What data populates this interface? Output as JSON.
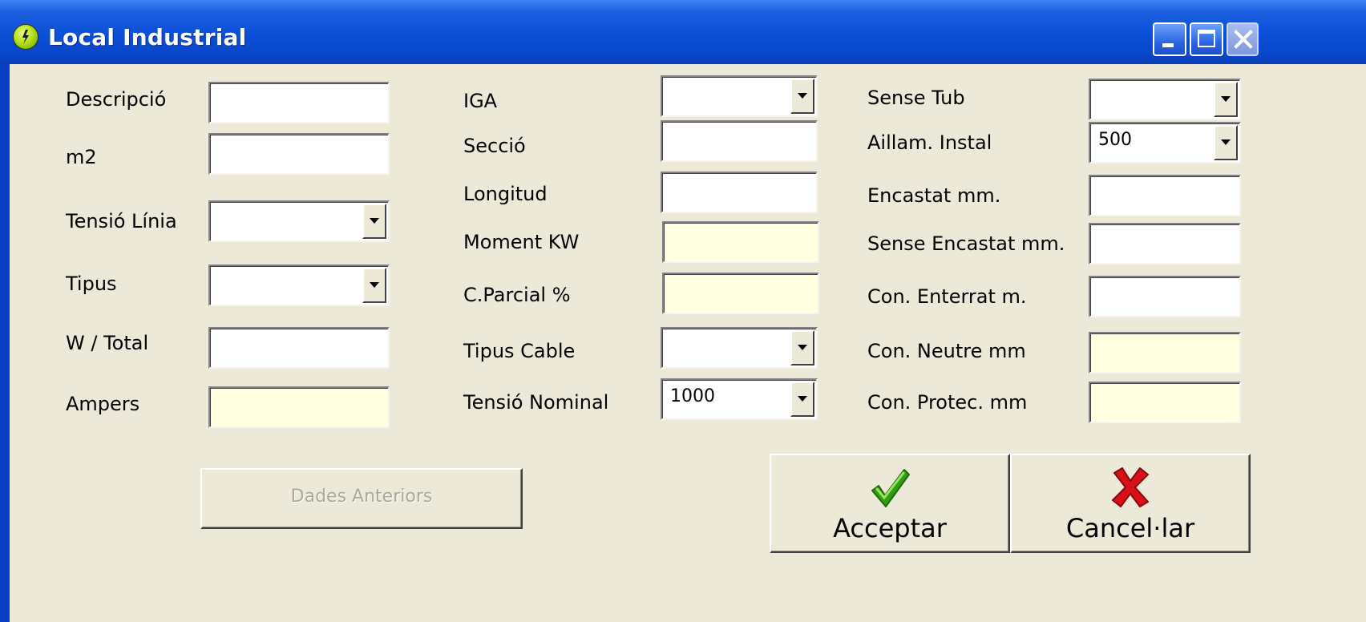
{
  "window": {
    "title": "Local Industrial",
    "icon": "app-logo-icon",
    "controls": [
      "minimize-icon",
      "maximize-icon",
      "close-icon"
    ],
    "colors": {
      "titlebar": "#0a4fd8",
      "client": "#ece9d8",
      "readonly_field": "#ffffe0"
    }
  },
  "col1": {
    "descripcio": {
      "label": "Descripció",
      "value": ""
    },
    "m2": {
      "label": "m2",
      "value": ""
    },
    "tensio_linia": {
      "label": "Tensió Línia",
      "value": ""
    },
    "tipus": {
      "label": "Tipus",
      "value": ""
    },
    "w_total": {
      "label": "W / Total",
      "value": ""
    },
    "ampers": {
      "label": "Ampers",
      "value": ""
    }
  },
  "col2": {
    "iga": {
      "label": "IGA",
      "value": ""
    },
    "seccio": {
      "label": "Secció",
      "value": ""
    },
    "longitud": {
      "label": "Longitud",
      "value": ""
    },
    "moment_kw": {
      "label": "Moment KW",
      "value": ""
    },
    "c_parcial": {
      "label": "C.Parcial %",
      "value": ""
    },
    "tipus_cable": {
      "label": "Tipus Cable",
      "value": ""
    },
    "tensio_nominal": {
      "label": "Tensió Nominal",
      "value": "1000"
    }
  },
  "col3": {
    "sense_tub": {
      "label": "Sense Tub",
      "value": ""
    },
    "aillam_instal": {
      "label": "Aillam. Instal",
      "value": "500"
    },
    "encastat": {
      "label": "Encastat mm.",
      "value": ""
    },
    "sense_encastat": {
      "label": "Sense Encastat mm.",
      "value": ""
    },
    "con_enterrat": {
      "label": "Con. Enterrat m.",
      "value": ""
    },
    "con_neutre": {
      "label": "Con. Neutre mm",
      "value": ""
    },
    "con_protec": {
      "label": "Con. Protec. mm",
      "value": ""
    }
  },
  "buttons": {
    "dades_anteriors": "Dades Anteriors",
    "acceptar": "Acceptar",
    "acceptar_icon": "checkmark-icon",
    "cancellar": "Cancel·lar",
    "cancellar_icon": "red-x-icon"
  }
}
